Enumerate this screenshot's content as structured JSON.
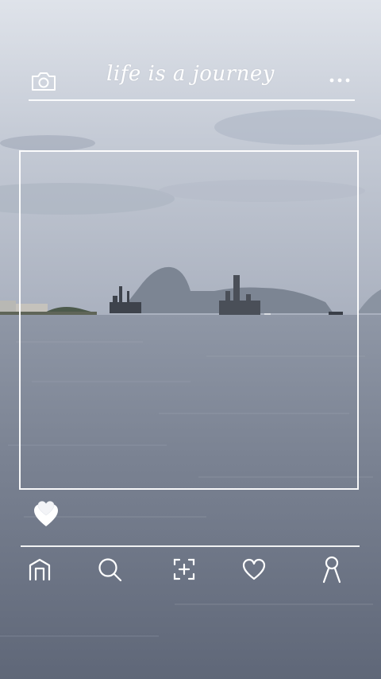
{
  "header": {
    "title": "life is a journey",
    "left_icon": "camera-icon",
    "right_icon": "more-dots-icon"
  },
  "reaction": {
    "icon": "heart-icon"
  },
  "nav": {
    "items": [
      {
        "icon": "home-icon"
      },
      {
        "icon": "search-icon"
      },
      {
        "icon": "add-photo-icon"
      },
      {
        "icon": "favorites-heart-icon"
      },
      {
        "icon": "profile-icon"
      }
    ]
  },
  "colors": {
    "overlay_stroke": "#ffffff",
    "sky": "#c9cfd8",
    "sea": "#6b7485"
  }
}
